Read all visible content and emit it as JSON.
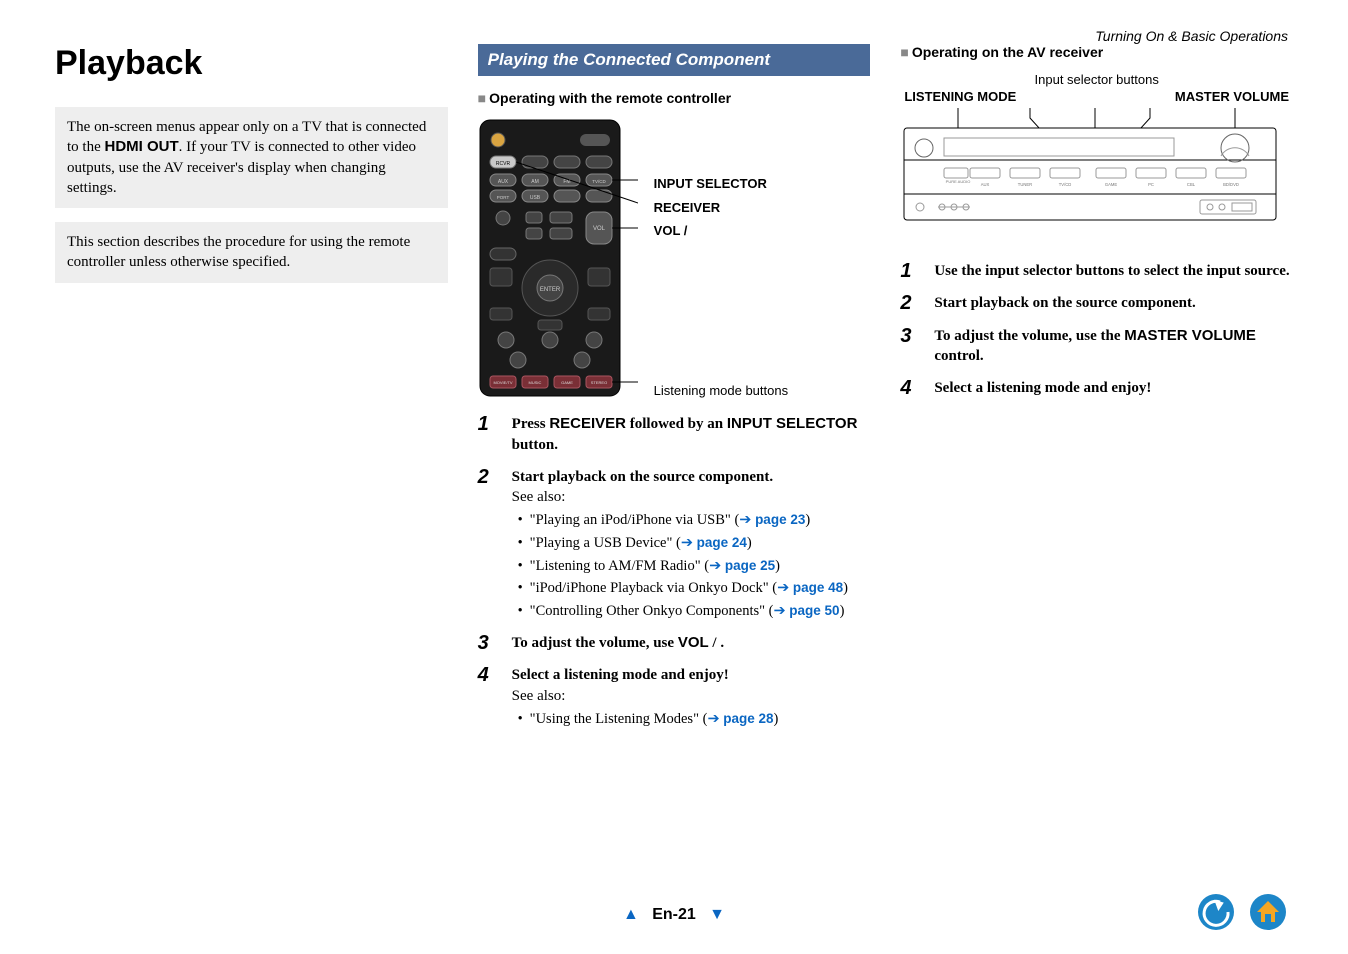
{
  "breadcrumb": "Turning On & Basic Operations",
  "title": "Playback",
  "info1_a": "The on-screen menus appear only on a TV that is connected to the ",
  "info1_bold": "HDMI OUT",
  "info1_b": ". If your TV is connected to other video outputs, use the AV receiver's display when changing settings.",
  "info2": "This section describes the procedure for using the remote controller unless otherwise specified.",
  "section_bar": "Playing the Connected Component",
  "sub_remote": "Operating with the remote controller",
  "callout_input": "INPUT SELECTOR",
  "callout_receiver": "RECEIVER",
  "callout_vol": "VOL   /",
  "listening_label": "Listening mode buttons",
  "steps_remote": {
    "s1_a": "Press ",
    "s1_b": "RECEIVER",
    "s1_c": " followed by an ",
    "s1_d": "INPUT SELECTOR",
    "s1_e": " button.",
    "s2_lead": "Start playback on the source component.",
    "s2_see": "See also:",
    "b1_t": "\"Playing an iPod/iPhone via USB\" (",
    "b1_l": "page 23",
    "b2_t": "\"Playing a USB Device\" (",
    "b2_l": "page 24",
    "b3_t": "\"Listening to AM/FM Radio\" (",
    "b3_l": "page 25",
    "b4_t": "\"iPod/iPhone Playback via Onkyo Dock\" (",
    "b4_l": "page 48",
    "b5_t": "\"Controlling Other Onkyo Components\" (",
    "b5_l": "page 50",
    "s3_a": "To adjust the volume, use ",
    "s3_b": "VOL",
    "s3_c": "   /   .",
    "s4_lead": "Select a listening mode and enjoy!",
    "s4_see": "See also:",
    "b6_t": "\"Using the Listening Modes\" (",
    "b6_l": "page 28"
  },
  "sub_receiver": "Operating on the AV receiver",
  "input_sel_btns": "Input selector buttons",
  "label_lm": "LISTENING MODE",
  "label_mv": "MASTER VOLUME",
  "receiver_button_labels": [
    "AUX",
    "TUNER",
    "TV/CD",
    "GAME",
    "PC",
    "CBL",
    "BD/DVD",
    "PURE AUDIO"
  ],
  "steps_receiver": {
    "r1": "Use the input selector buttons to select the input source.",
    "r2": "Start playback on the source component.",
    "r3_a": "To adjust the volume, use the ",
    "r3_b": "MASTER VOLUME",
    "r3_c": " control.",
    "r4": "Select a listening mode and enjoy!"
  },
  "page_num": "En-21"
}
